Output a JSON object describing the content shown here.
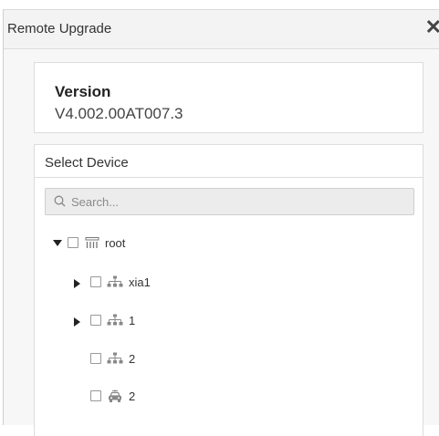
{
  "dialog": {
    "title": "Remote Upgrade",
    "close_icon": "close-icon"
  },
  "version": {
    "label": "Version",
    "value": "V4.002.00AT007.3"
  },
  "device": {
    "title": "Select Device",
    "search": {
      "placeholder": "Search...",
      "value": ""
    },
    "tree": [
      {
        "label": "root",
        "icon": "device-group-icon",
        "expander": "expanded",
        "checked": false
      },
      {
        "label": "xia1",
        "icon": "network-org-icon",
        "expander": "collapsed",
        "checked": false
      },
      {
        "label": "1",
        "icon": "network-org-icon",
        "expander": "collapsed",
        "checked": false
      },
      {
        "label": "2",
        "icon": "network-org-icon",
        "expander": "none",
        "checked": false
      },
      {
        "label": "2",
        "icon": "vehicle-icon",
        "expander": "none",
        "checked": false
      }
    ]
  }
}
